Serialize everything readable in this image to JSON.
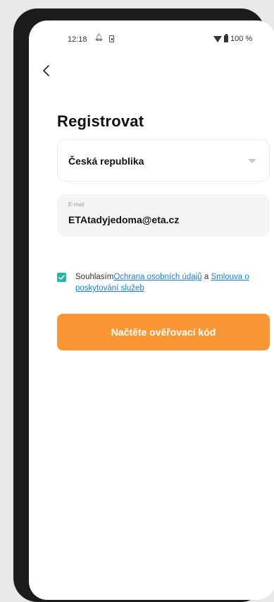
{
  "status_bar": {
    "time": "12:18",
    "battery": "100 %",
    "icons": [
      "notification-icon",
      "sim-icon",
      "wifi-icon",
      "battery-icon"
    ]
  },
  "nav": {
    "back_icon": "chevron-left-icon"
  },
  "page": {
    "title": "Registrovat"
  },
  "country": {
    "selected": "Česká republika",
    "icon": "chevron-down-icon"
  },
  "email": {
    "label": "E-mail",
    "value": "ETAtadyjedoma@eta.cz"
  },
  "agreement": {
    "checked": true,
    "prefix": "Souhlasím",
    "privacy_link": "Ochrana osobních údajů",
    "connector": " a ",
    "terms_link": "Smlouva o poskytování služeb"
  },
  "submit": {
    "label": "Načtěte ověřovací kód"
  },
  "colors": {
    "accent": "#fa9734",
    "link": "#1a7fd4",
    "checkbox": "#1fb8a5"
  }
}
